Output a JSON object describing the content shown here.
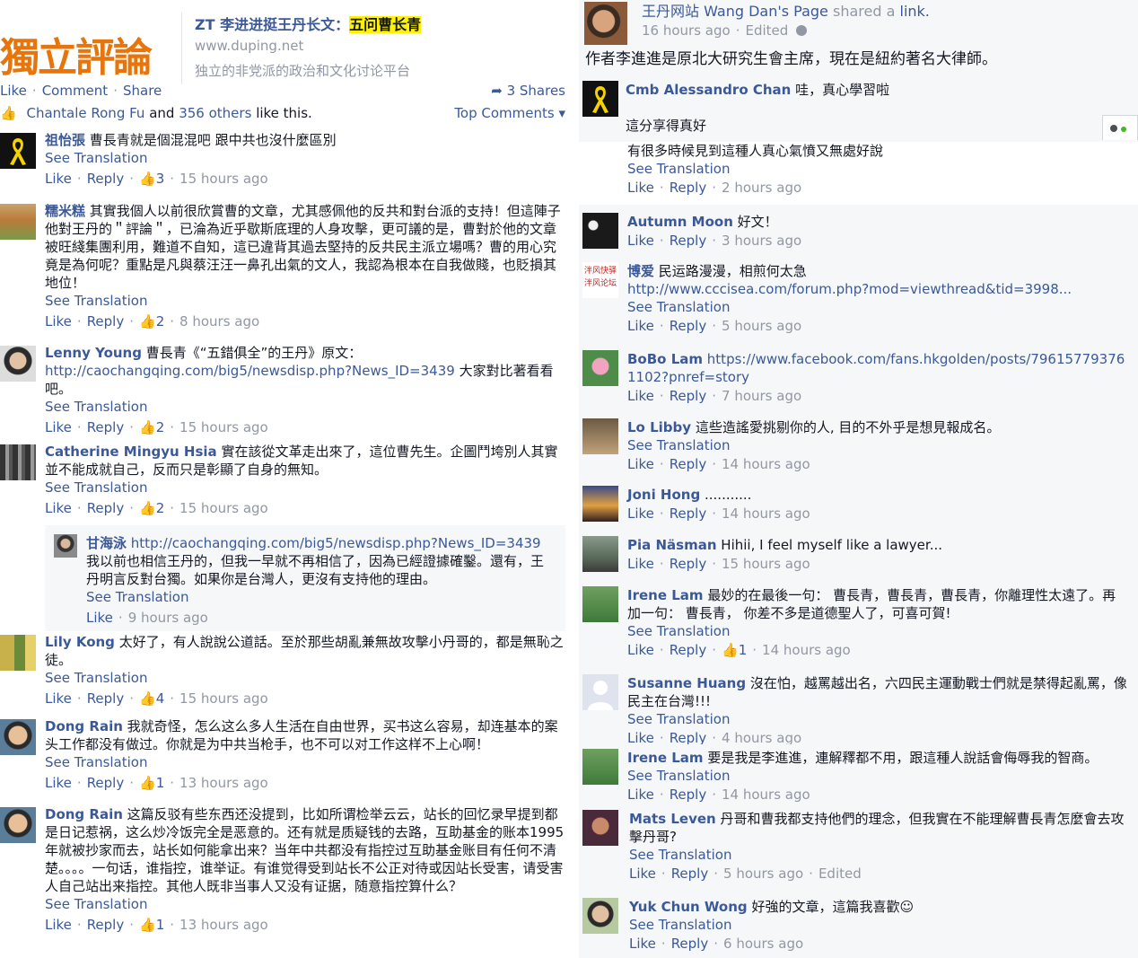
{
  "left": {
    "article": {
      "logo_text": "獨立評論",
      "title_prefix": "ZT 李进进挺王丹长文：",
      "title_highlight": "五问曹长青",
      "domain": "www.duping.net",
      "description": "独立的非党派的政治和文化讨论平台"
    },
    "post_actions": {
      "like": "Like",
      "comment": "Comment",
      "share": "Share",
      "shares": "3 Shares"
    },
    "likes_line": {
      "name": "Chantale Rong Fu",
      "and": "and",
      "others": "356 others",
      "suffix": "like this."
    },
    "top_comments": "Top Comments ▾",
    "comments": [
      {
        "name": "祖怡張",
        "text": "曹長青就是個混混吧 跟中共也沒什麼區別",
        "see": "See Translation",
        "like": "Like",
        "reply": "Reply",
        "likes": "3",
        "time": "15 hours ago"
      },
      {
        "name": "糯米糕",
        "text": "其實我個人以前很欣賞曹的文章，尤其感佩他的反共和對台派的支持！但這陣子他對王丹的＂評論＂，已淪為近乎歇斯底理的人身攻擊，更可議的是，曹對於他的文章被旺綫集團利用，難道不自知，這已違背其過去堅持的反共民主派立場嗎？曹的用心究竟是為何呢？重點是凡與蔡汪汪一鼻孔出氣的文人，我認為根本在自我做賤，也貶損其地位！",
        "see": "See Translation",
        "like": "Like",
        "reply": "Reply",
        "likes": "2",
        "time": "8 hours ago"
      },
      {
        "name": "Lenny Young",
        "text_pre": "曹長青《“五錯俱全”的王丹》原文：",
        "url": "http://caochangqing.com/big5/newsdisp.php?News_ID=3439",
        "text_post": " 大家對比著看看吧。",
        "see": "See Translation",
        "like": "Like",
        "reply": "Reply",
        "likes": "2",
        "time": "15 hours ago"
      },
      {
        "name": "Catherine Mingyu Hsia",
        "text": "實在該從文革走出來了，這位曹先生。企圖鬥垮別人其實並不能成就自己，反而只是彰顯了自身的無知。",
        "see": "See Translation",
        "like": "Like",
        "reply": "Reply",
        "likes": "2",
        "time": "15 hours ago"
      },
      {
        "name": "甘海泳",
        "url": "http://caochangqing.com/big5/newsdisp.php?News_ID=3439",
        "text": "我以前也相信王丹的，但我一早就不再相信了，因為已經證據確鑿。還有，王丹明言反對台獨。如果你是台灣人，更沒有支持他的理由。",
        "see": "See Translation",
        "like": "Like",
        "time": "9 hours ago"
      },
      {
        "name": "Lily Kong",
        "text": "太好了，有人說說公道話。至於那些胡亂兼無故攻擊小丹哥的，都是無恥之徒。",
        "see": "See Translation",
        "like": "Like",
        "reply": "Reply",
        "likes": "4",
        "time": "15 hours ago"
      },
      {
        "name": "Dong Rain",
        "text": "我就奇怪，怎么这么多人生活在自由世界，买书这么容易，却连基本的案头工作都没有做过。你就是为中共当枪手，也不可以对工作这样不上心啊！",
        "see": "See Translation",
        "like": "Like",
        "reply": "Reply",
        "likes": "1",
        "time": "13 hours ago"
      },
      {
        "name": "Dong Rain",
        "text": "这篇反驳有些东西还没提到，比如所谓检举云云，站长的回忆录早提到都是日记惹祸，这么炒冷饭完全是恶意的。还有就是质疑钱的去路，互助基金的账本1995年就被抄家而去，站长如何能拿出来？当年中共都没有指控过互助基金账目有任何不清楚。。。。一句话，谁指控，谁举证。有谁觉得受到站长不公正对待或因站长受害，请受害人自己站出来指控。其他人既非当事人又没有证据，随意指控算什么？",
        "see": "See Translation",
        "like": "Like",
        "reply": "Reply",
        "likes": "1",
        "time": "13 hours ago"
      }
    ]
  },
  "right": {
    "page_name": "王丹网站 Wang Dan's Page",
    "shared": "shared a",
    "link_word": "link.",
    "post_time": "16 hours ago",
    "edited": "Edited",
    "post_text": "作者李進進是原北大研究生會主席，現在是紐約著名大律師。",
    "comments": [
      {
        "name": "Cmb Alessandro Chan",
        "text": "哇，真心學習啦"
      },
      {
        "name": "",
        "text": "這分享得真好"
      },
      {
        "name": "",
        "text": "有很多時候見到這種人真心氣憤又無處好說",
        "see": "See Translation",
        "like": "Like",
        "reply": "Reply",
        "time": "2 hours ago"
      },
      {
        "name": "Autumn Moon",
        "text": "好文！",
        "like": "Like",
        "reply": "Reply",
        "time": "3 hours ago"
      },
      {
        "name": "博爱",
        "text": "民运路漫漫，相煎何太急",
        "url": "http://www.cccisea.com/forum.php?mod=viewthread&tid=3998...",
        "see": "See Translation",
        "like": "Like",
        "reply": "Reply",
        "time": "5 hours ago",
        "avatar_text": "泮风快驿 泮风论坛"
      },
      {
        "name": "BoBo Lam",
        "url": "https://www.facebook.com/fans.hkgolden/posts/796157793761102?pnref=story",
        "like": "Like",
        "reply": "Reply",
        "time": "7 hours ago"
      },
      {
        "name": "Lo Libby",
        "text": "這些造謠愛挑剔你的人, 目的不外乎是想見報成名。",
        "see": "See Translation",
        "like": "Like",
        "reply": "Reply",
        "time": "14 hours ago"
      },
      {
        "name": "Joni Hong",
        "text": "...........",
        "like": "Like",
        "reply": "Reply",
        "time": "14 hours ago"
      },
      {
        "name": "Pia Näsman",
        "text": "Hihii, I feel myself like a lawyer...",
        "like": "Like",
        "reply": "Reply",
        "time": "15 hours ago"
      },
      {
        "name": "Irene Lam",
        "text": "最妙的在最後一句： 曹長青，曹長青，曹長青，你離理性太遠了。再加一句： 曹長青， 你差不多是道德聖人了，可喜可賀!",
        "see": "See Translation",
        "like": "Like",
        "reply": "Reply",
        "likes": "1",
        "time": "14 hours ago"
      },
      {
        "name": "Susanne Huang",
        "text": "沒在怕，越罵越出名，六四民主運動戰士們就是禁得起亂罵，像民主在台灣!!!",
        "see": "See Translation",
        "like": "Like",
        "reply": "Reply",
        "time": "4 hours ago"
      },
      {
        "name": "Irene Lam",
        "text": "要是我是李進進，連解釋都不用，跟這種人說話會侮辱我的智商。",
        "see": "See Translation",
        "like": "Like",
        "reply": "Reply",
        "time": "14 hours ago"
      },
      {
        "name": "Mats Leven",
        "text": "丹哥和曹我都支持他們的理念，但我實在不能理解曹長青怎麼會去攻擊丹哥?",
        "see": "See Translation",
        "like": "Like",
        "reply": "Reply",
        "time": "5 hours ago",
        "edited": "Edited"
      },
      {
        "name": "Yuk Chun Wong",
        "text": "好強的文章，這篇我喜歡☺",
        "see": "See Translation",
        "like": "Like",
        "reply": "Reply",
        "time": "6 hours ago"
      }
    ]
  }
}
